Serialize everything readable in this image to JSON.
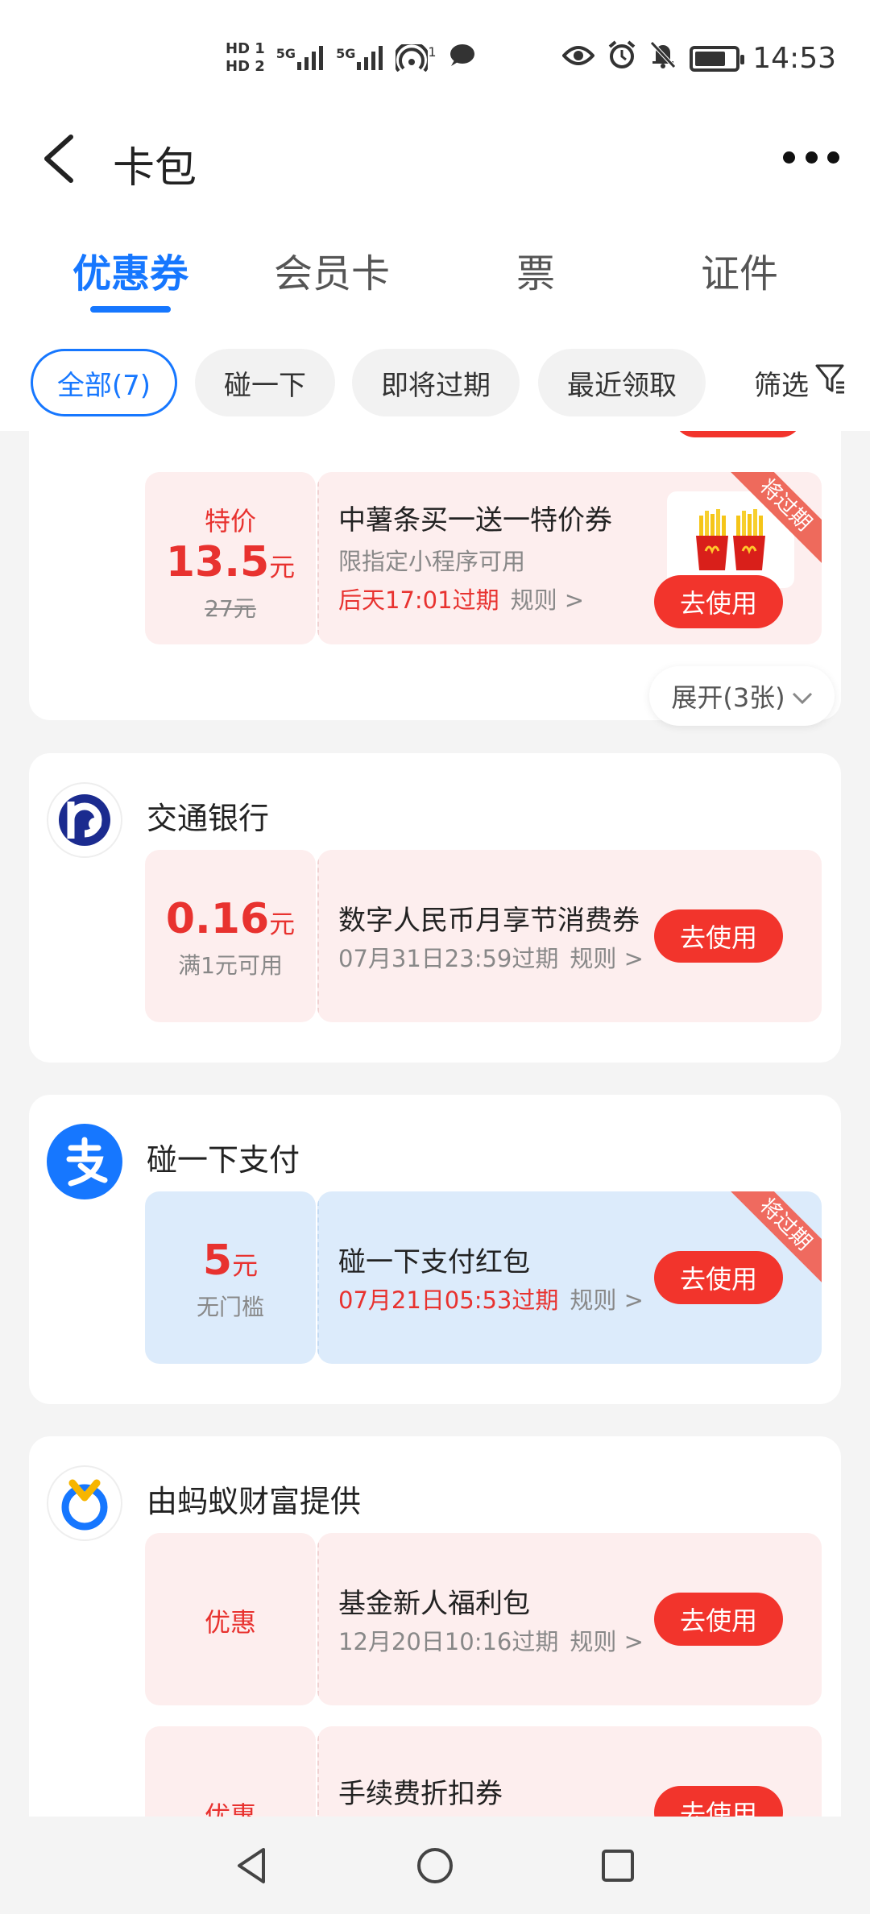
{
  "status_bar": {
    "hd1": "HD 1",
    "hd2": "HD 2",
    "sig1": "5G",
    "sig2": "5G",
    "hotspot_num": "1",
    "time": "14:53",
    "battery_level": 0.8
  },
  "header": {
    "title": "卡包"
  },
  "tabs": [
    {
      "label": "优惠券",
      "active": true
    },
    {
      "label": "会员卡",
      "active": false
    },
    {
      "label": "票",
      "active": false
    },
    {
      "label": "证件",
      "active": false
    }
  ],
  "filters": {
    "chips": [
      {
        "label": "全部(7)",
        "active": true
      },
      {
        "label": "碰一下",
        "active": false
      },
      {
        "label": "即将过期",
        "active": false
      },
      {
        "label": "最近领取",
        "active": false
      }
    ],
    "filter_label": "筛选"
  },
  "mcd_card": {
    "coupon": {
      "price_label": "特价",
      "price": "13.5",
      "unit": "元",
      "original_price": "27元",
      "title": "中薯条买一送一特价券",
      "desc": "限指定小程序可用",
      "expire": "后天17:01过期",
      "rule": "规则 >",
      "button": "去使用",
      "ribbon": "将过期"
    },
    "expand": "展开(3张)"
  },
  "bocom_card": {
    "merchant": "交通银行",
    "coupon": {
      "amount": "0.16",
      "unit": "元",
      "condition": "满1元可用",
      "title": "数字人民币月享节消费券",
      "expire": "07月31日23:59过期",
      "rule": "规则 >",
      "button": "去使用"
    }
  },
  "pay_card": {
    "merchant": "碰一下支付",
    "coupon": {
      "amount": "5",
      "unit": "元",
      "condition": "无门槛",
      "title": "碰一下支付红包",
      "expire": "07月21日05:53过期",
      "rule": "规则 >",
      "button": "去使用",
      "ribbon": "将过期"
    }
  },
  "ant_card": {
    "merchant": "由蚂蚁财富提供",
    "coupons": [
      {
        "label": "优惠",
        "title": "基金新人福利包",
        "expire": "12月20日10:16过期",
        "rule": "规则 >",
        "button": "去使用"
      },
      {
        "label": "优惠",
        "title": "手续费折扣券",
        "button": "去使用"
      }
    ]
  },
  "colors": {
    "accent_blue": "#1677ff",
    "coupon_red": "#e8322f",
    "button_red": "#f2342c"
  }
}
